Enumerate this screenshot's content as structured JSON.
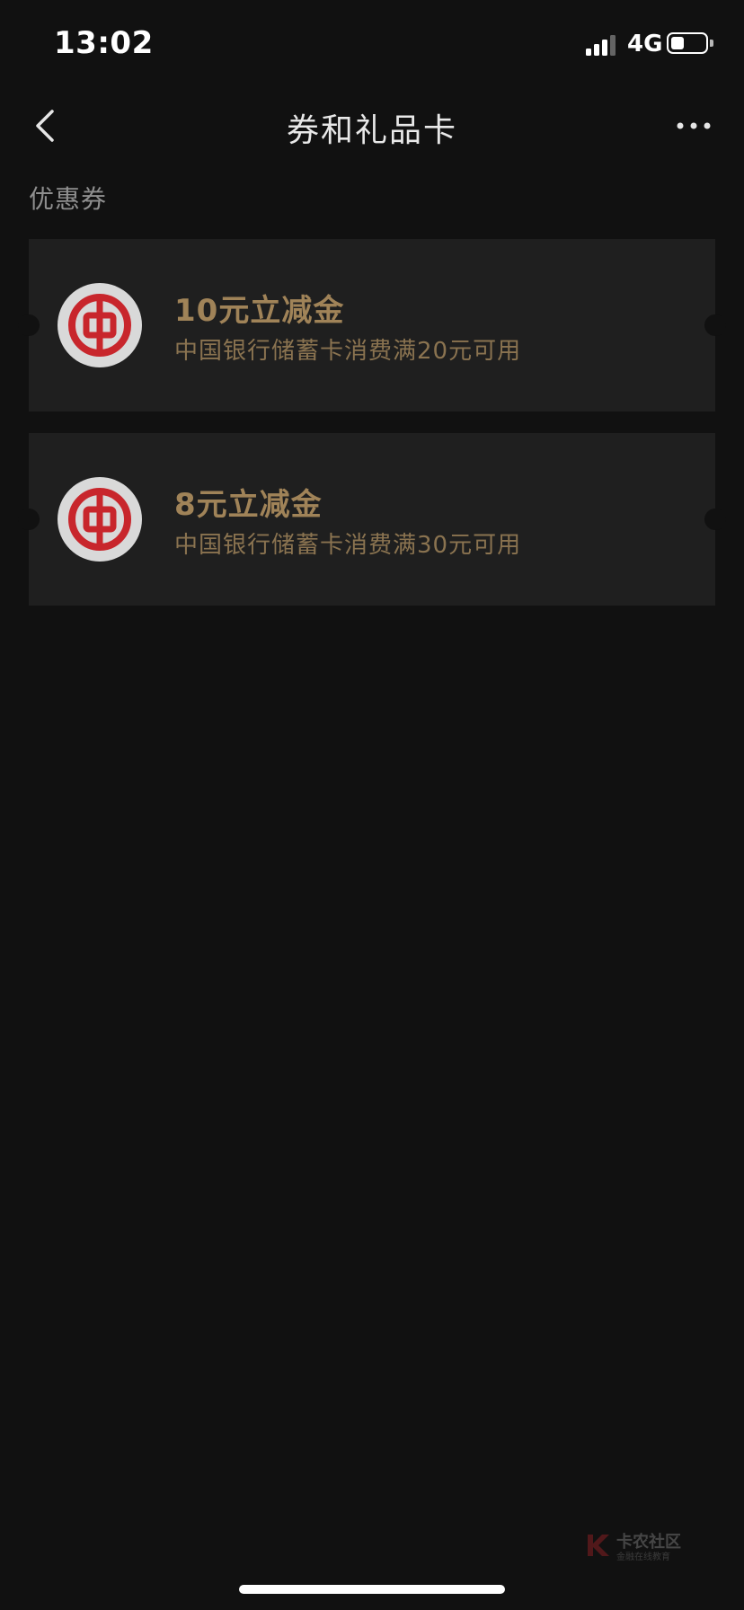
{
  "status_bar": {
    "time": "13:02",
    "network": "4G",
    "battery_level": 0.4,
    "signal_bars": 3
  },
  "nav": {
    "title": "券和礼品卡",
    "back_icon": "chevron-left-icon",
    "more_icon": "more-horizontal-icon"
  },
  "section": {
    "label": "优惠券"
  },
  "coupons": [
    {
      "title": "10元立减金",
      "description": "中国银行储蓄卡消费满20元可用",
      "logo": "bank-of-china-logo"
    },
    {
      "title": "8元立减金",
      "description": "中国银行储蓄卡消费满30元可用",
      "logo": "bank-of-china-logo"
    }
  ],
  "watermark": {
    "brand": "卡农社区",
    "subtitle": "金融在线教育"
  },
  "colors": {
    "background": "#111111",
    "card": "#1f1f1f",
    "coupon_title": "#a08358",
    "coupon_desc": "#8a7350",
    "logo_red": "#c8262c",
    "logo_bg": "#d9d9d9"
  }
}
